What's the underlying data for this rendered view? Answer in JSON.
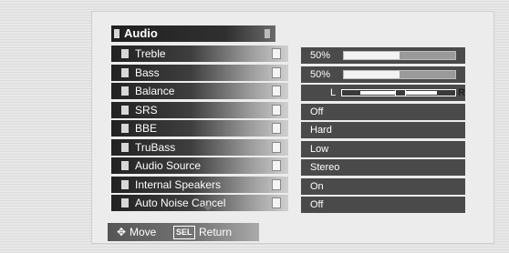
{
  "menu": {
    "title": "Audio",
    "items": [
      {
        "label": "Treble"
      },
      {
        "label": "Bass"
      },
      {
        "label": "Balance"
      },
      {
        "label": "SRS"
      },
      {
        "label": "BBE"
      },
      {
        "label": "TruBass"
      },
      {
        "label": "Audio Source"
      },
      {
        "label": "Internal Speakers"
      },
      {
        "label": "Auto Noise Cancel"
      }
    ]
  },
  "settings": {
    "treble": {
      "value_text": "50%",
      "level": 0.5
    },
    "bass": {
      "value_text": "50%",
      "level": 0.5
    },
    "balance": {
      "left_label": "L",
      "right_label": "R",
      "level": 0.5
    },
    "srs": {
      "value": "Off"
    },
    "bbe": {
      "value": "Hard"
    },
    "trubass": {
      "value": "Low"
    },
    "audio_source": {
      "value": "Stereo"
    },
    "internal_speakers": {
      "value": "On"
    },
    "auto_noise_cancel": {
      "value": "Off"
    }
  },
  "footer": {
    "move_icon": "four-way-arrow-icon",
    "move_label": "Move",
    "sel_icon_text": "SEL",
    "return_label": "Return"
  },
  "colors": {
    "row_dark": "#222222",
    "value_bg": "#4a4a4a",
    "text": "#ffffff"
  }
}
